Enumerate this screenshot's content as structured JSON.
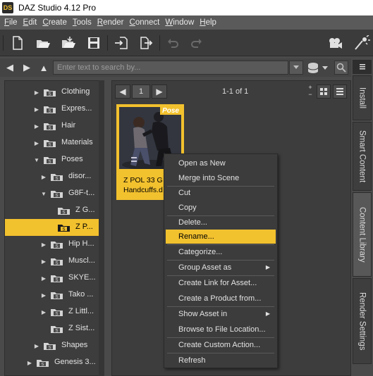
{
  "window": {
    "title": "DAZ Studio 4.12 Pro",
    "icon_text": "DS"
  },
  "menu": [
    {
      "label": "File",
      "u": "F",
      "rest": "ile"
    },
    {
      "label": "Edit",
      "u": "E",
      "rest": "dit"
    },
    {
      "label": "Create",
      "u": "C",
      "rest": "reate"
    },
    {
      "label": "Tools",
      "u": "T",
      "rest": "ools"
    },
    {
      "label": "Render",
      "u": "R",
      "rest": "ender"
    },
    {
      "label": "Connect",
      "u": "C",
      "rest": "onnect"
    },
    {
      "label": "Window",
      "u": "W",
      "rest": "indow"
    },
    {
      "label": "Help",
      "u": "H",
      "rest": "elp"
    }
  ],
  "search": {
    "placeholder": "Enter text to search by..."
  },
  "tree": [
    {
      "label": "Clothing",
      "arrow": "right"
    },
    {
      "label": "Expres...",
      "arrow": "right"
    },
    {
      "label": "Hair",
      "arrow": "right"
    },
    {
      "label": "Materials",
      "arrow": "right"
    },
    {
      "label": "Poses",
      "arrow": "down"
    },
    {
      "label": "disor...",
      "arrow": "right"
    },
    {
      "label": "G8F-t...",
      "arrow": "down"
    },
    {
      "label": "Z G...",
      "arrow": "none"
    },
    {
      "label": "Z P...",
      "arrow": "none",
      "selected": true
    },
    {
      "label": "Hip H...",
      "arrow": "right"
    },
    {
      "label": "Muscl...",
      "arrow": "right"
    },
    {
      "label": "SKYE...",
      "arrow": "right"
    },
    {
      "label": "Tako ...",
      "arrow": "right"
    },
    {
      "label": "Z Littl...",
      "arrow": "right"
    },
    {
      "label": "Z Sist...",
      "arrow": "none"
    },
    {
      "label": "Shapes",
      "arrow": "right"
    },
    {
      "label": "Genesis 3...",
      "arrow": "right"
    }
  ],
  "paging": {
    "page": "1",
    "count": "1-1 of 1"
  },
  "asset": {
    "badge": "Pose",
    "label_line1": "Z POL 33 G",
    "label_line2": "Handcuffs.d"
  },
  "side_tabs": [
    "Install",
    "Smart Content",
    "Content Library",
    "Render Settings"
  ],
  "context_menu": {
    "open_as_new": "Open as New",
    "merge": "Merge into Scene",
    "cut": "Cut",
    "copy": "Copy",
    "delete": "Delete...",
    "rename": "Rename...",
    "categorize": "Categorize...",
    "group_asset_as": "Group Asset as",
    "create_link": "Create Link for Asset...",
    "create_product": "Create a Product from...",
    "show_asset_in": "Show Asset in",
    "browse": "Browse to File Location...",
    "custom_action": "Create Custom Action...",
    "refresh": "Refresh"
  },
  "colors": {
    "accent": "#f2c12e",
    "panel": "#3d3d3d",
    "background": "#4a4a4a"
  }
}
